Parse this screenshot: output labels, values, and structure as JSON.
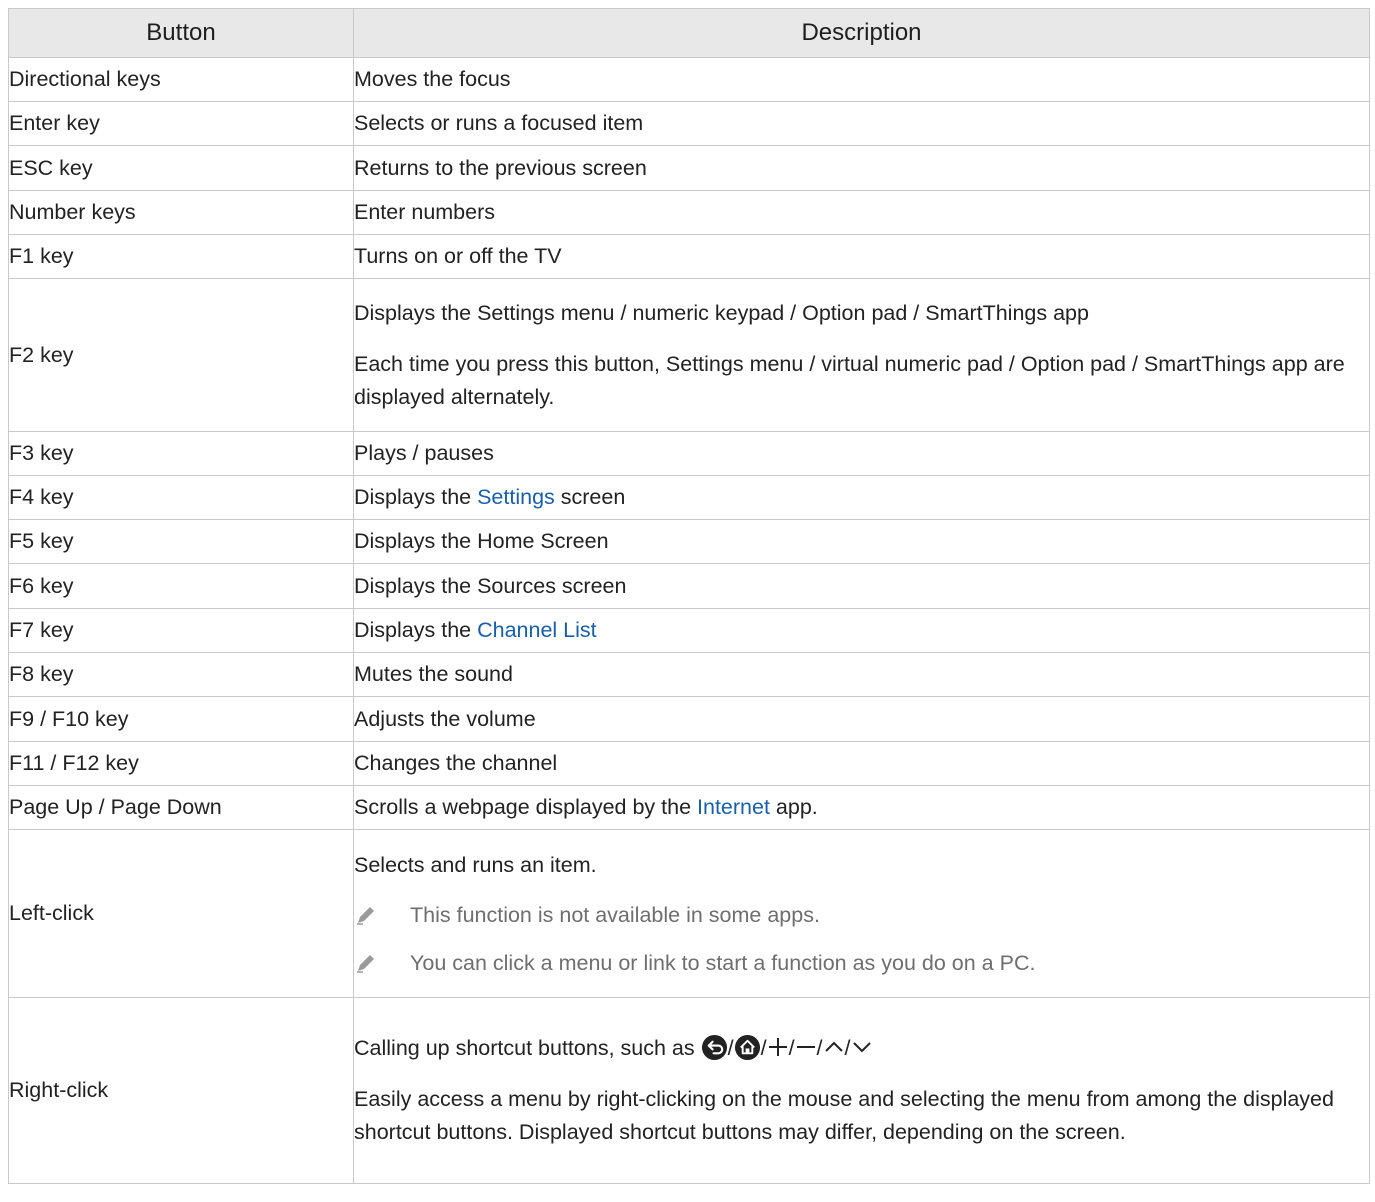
{
  "table": {
    "headers": {
      "button": "Button",
      "description": "Description"
    },
    "rows": [
      {
        "button": "Directional keys",
        "description": "Moves the focus"
      },
      {
        "button": "Enter key",
        "description": "Selects or runs a focused item"
      },
      {
        "button": "ESC key",
        "description": "Returns to the previous screen"
      },
      {
        "button": "Number keys",
        "description": "Enter numbers"
      },
      {
        "button": "F1 key",
        "description": "Turns on or off the TV"
      },
      {
        "button": "F2 key",
        "description": "Displays the Settings menu / numeric keypad / Option pad / SmartThings app",
        "description2": "Each time you press this button, Settings menu / virtual numeric pad / Option pad / SmartThings app are displayed alternately."
      },
      {
        "button": "F3 key",
        "description": "Plays / pauses"
      },
      {
        "button": "F4 key",
        "pre": "Displays the ",
        "link": "Settings",
        "post": " screen"
      },
      {
        "button": "F5 key",
        "description": "Displays the Home Screen"
      },
      {
        "button": "F6 key",
        "description": "Displays the Sources screen"
      },
      {
        "button": "F7 key",
        "pre": "Displays the ",
        "link": "Channel List",
        "post": ""
      },
      {
        "button": "F8 key",
        "description": "Mutes the sound"
      },
      {
        "button": "F9 / F10 key",
        "description": "Adjusts the volume"
      },
      {
        "button": "F11 / F12 key",
        "description": "Changes the channel"
      },
      {
        "button": "Page Up / Page Down",
        "pre": "Scrolls a webpage displayed by the ",
        "link": "Internet",
        "post": " app."
      },
      {
        "button": "Left-click",
        "description": "Selects and runs an item.",
        "notes": [
          "This function is not available in some apps.",
          "You can click a menu or link to start a function as you do on a PC."
        ]
      },
      {
        "button": "Right-click",
        "shortcut_intro": "Calling up shortcut buttons, such as ",
        "shortcut_icons": [
          "back-icon",
          "home-icon",
          "plus-icon",
          "minus-icon",
          "up-arrow-icon",
          "down-arrow-icon"
        ],
        "separator": "/",
        "description2": "Easily access a menu by right-clicking on the mouse and selecting the menu from among the displayed shortcut buttons. Displayed shortcut buttons may differ, depending on the screen."
      }
    ]
  },
  "colors": {
    "header_bg": "#e8e8e8",
    "link": "#1a5ea8",
    "note_text": "#6e6e6e",
    "border": "#c9c9c9"
  }
}
